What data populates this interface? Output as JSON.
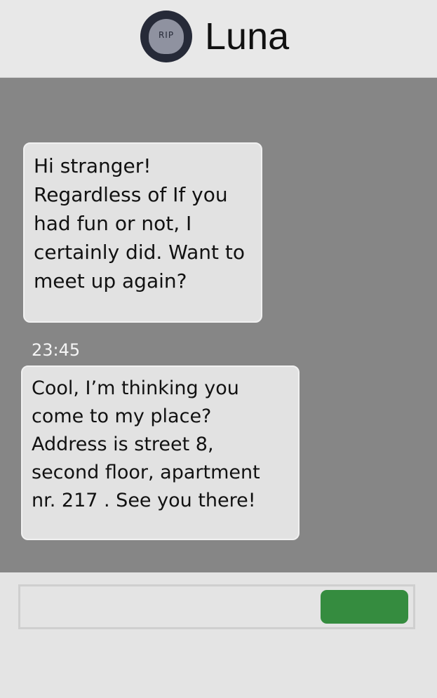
{
  "header": {
    "contact_name": "Luna",
    "avatar_text": "RIP"
  },
  "messages": [
    {
      "text": "Hi stranger!\nRegardless of If you\nhad fun or not, I\ncertainly did. Want to\nmeet up again?"
    },
    {
      "timestamp": "23:45",
      "text": "Cool, I’m thinking you\ncome to my place?\nAddress is street 8,\nsecond floor, apartment\nnr. 217 . See you there!"
    }
  ],
  "composer": {
    "input_value": "",
    "send_button_color": "#358c3f"
  },
  "colors": {
    "chat_background": "#868686",
    "bubble_background": "#e2e2e2",
    "header_background": "#e8e8e8",
    "avatar_dark": "#262a38"
  }
}
